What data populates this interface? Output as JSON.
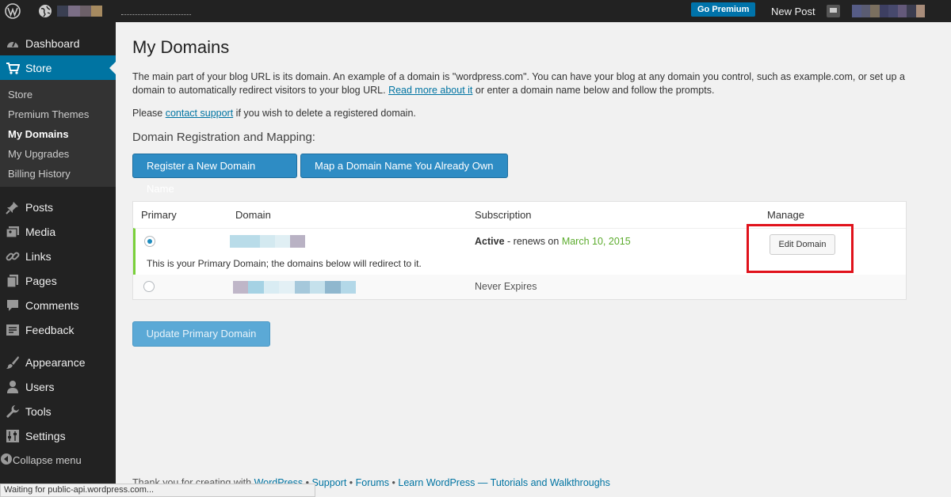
{
  "adminbar": {
    "go_premium": "Go Premium",
    "new_post": "New Post",
    "blog_swatch_colors": [
      "#3a3f52",
      "#7b6e86",
      "#6c6068",
      "#a68a60"
    ],
    "avatar_swatch_colors": [
      "#565c86",
      "#5a5c73",
      "#7a6f5f",
      "#3d3f62",
      "#47496d",
      "#64597a",
      "#3c3d50",
      "#a88c7a"
    ]
  },
  "sidebar": {
    "dashboard": "Dashboard",
    "store": "Store",
    "submenu": [
      "Store",
      "Premium Themes",
      "My Domains",
      "My Upgrades",
      "Billing History"
    ],
    "posts": "Posts",
    "media": "Media",
    "links": "Links",
    "pages": "Pages",
    "comments": "Comments",
    "feedback": "Feedback",
    "appearance": "Appearance",
    "users": "Users",
    "tools": "Tools",
    "settings": "Settings",
    "collapse": "Collapse menu"
  },
  "page": {
    "title": "My Domains",
    "intro_part1": "The main part of your blog URL is its domain. An example of a domain is \"wordpress.com\". You can have your blog at any domain you control, such as example.com, or set up a domain to automatically redirect visitors to your blog URL.",
    "intro_link": "Read more about it",
    "intro_part2": "or enter a domain name below and follow the prompts.",
    "delete_prefix": "Please",
    "delete_link": "contact support",
    "delete_suffix": "if you wish to delete a registered domain.",
    "section_heading": "Domain Registration and Mapping:",
    "register_button": "Register a New Domain Name",
    "map_button": "Map a Domain Name You Already Own"
  },
  "table": {
    "headers": {
      "primary": "Primary",
      "domain": "Domain",
      "subscription": "Subscription",
      "manage": "Manage"
    },
    "rows": [
      {
        "selected": true,
        "swatch_colors": [
          "#b9dce9",
          "#b9dce9",
          "#d3e9f0",
          "#e0eff4",
          "#b9b2c4"
        ],
        "status": "Active",
        "renew_text": "- renews on",
        "renew_date": "March 10, 2015",
        "manage_button": "Edit Domain",
        "note": "This is your Primary Domain; the domains below will redirect to it."
      },
      {
        "selected": false,
        "swatch_colors": [
          "#bfb6c8",
          "#a5d2e4",
          "#d9ecf3",
          "#e3f0f5",
          "#a5c8db",
          "#c5e1ec",
          "#8fb7ce",
          "#b3d8e8"
        ],
        "status_text": "Never Expires"
      }
    ],
    "highlight_color": "#e0121b"
  },
  "update_button": "Update Primary Domain",
  "footer": {
    "thanks": "Thank you for creating with",
    "wordpress_link": "WordPress",
    "sep": "•",
    "support": "Support",
    "forums": "Forums",
    "learn": "Learn WordPress — Tutorials and Walkthroughs"
  },
  "statusbar": "Waiting for public-api.wordpress.com..."
}
